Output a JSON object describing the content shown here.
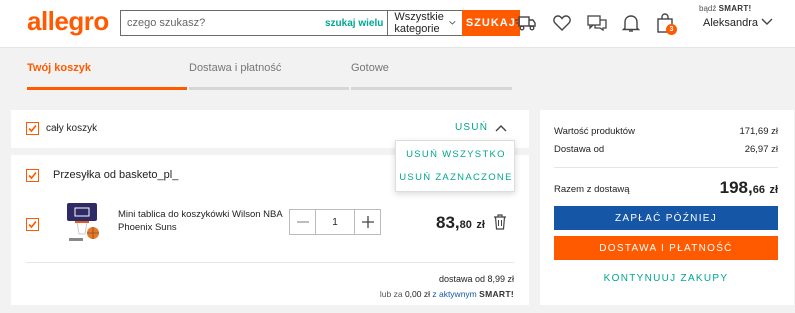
{
  "header": {
    "logo": "allegro",
    "search": {
      "placeholder": "czego szukasz?",
      "search_many": "szukaj wielu",
      "category": "Wszystkie kategorie",
      "button": "SZUKAJ"
    },
    "cart_count": "3",
    "user": {
      "prefix": "bądź",
      "smart": "SMART!",
      "name": "Aleksandra"
    }
  },
  "steps": [
    {
      "label": "Twój koszyk",
      "active": true
    },
    {
      "label": "Dostawa i płatność",
      "active": false
    },
    {
      "label": "Gotowe",
      "active": false
    }
  ],
  "cart": {
    "select_all_label": "cały koszyk",
    "remove_label": "USUŃ",
    "dropdown": {
      "remove_all": "USUŃ WSZYSTKO",
      "remove_selected": "USUŃ ZAZNACZONE"
    },
    "shipment": {
      "title": "Przesyłka od basketo_pl_",
      "item": {
        "name_line1": "Mini tablica do koszykówki Wilson NBA",
        "name_line2": "Phoenix Suns",
        "quantity": "1",
        "price_main": "83,",
        "price_cents": "80",
        "price_currency": "zł"
      },
      "delivery_text": "dostawa od 8,99 zł",
      "smart_prefix": "lub za",
      "smart_price": "0,00 zł",
      "smart_link": "z aktywnym",
      "smart_badge": "SMART!"
    }
  },
  "summary": {
    "products_label": "Wartość produktów",
    "products_value": "171,69 zł",
    "delivery_label": "Dostawa od",
    "delivery_value": "26,97 zł",
    "total_label": "Razem z dostawą",
    "total_main": "198,",
    "total_cents": "66",
    "total_currency": "zł",
    "pay_later": "ZAPŁAĆ PÓŹNIEJ",
    "checkout": "DOSTAWA I PŁATNOŚĆ",
    "continue": "KONTYNUUJ ZAKUPY"
  },
  "colors": {
    "brand": "#ff5a00",
    "teal": "#00a790",
    "pay_later": "#1656a6"
  },
  "icons": [
    "delivery-truck-icon",
    "heart-icon",
    "messages-icon",
    "bell-icon",
    "shopping-bag-icon",
    "chevron-down-icon",
    "chevron-up-icon",
    "trash-icon",
    "minus-icon",
    "plus-icon",
    "checkbox-check-icon"
  ]
}
